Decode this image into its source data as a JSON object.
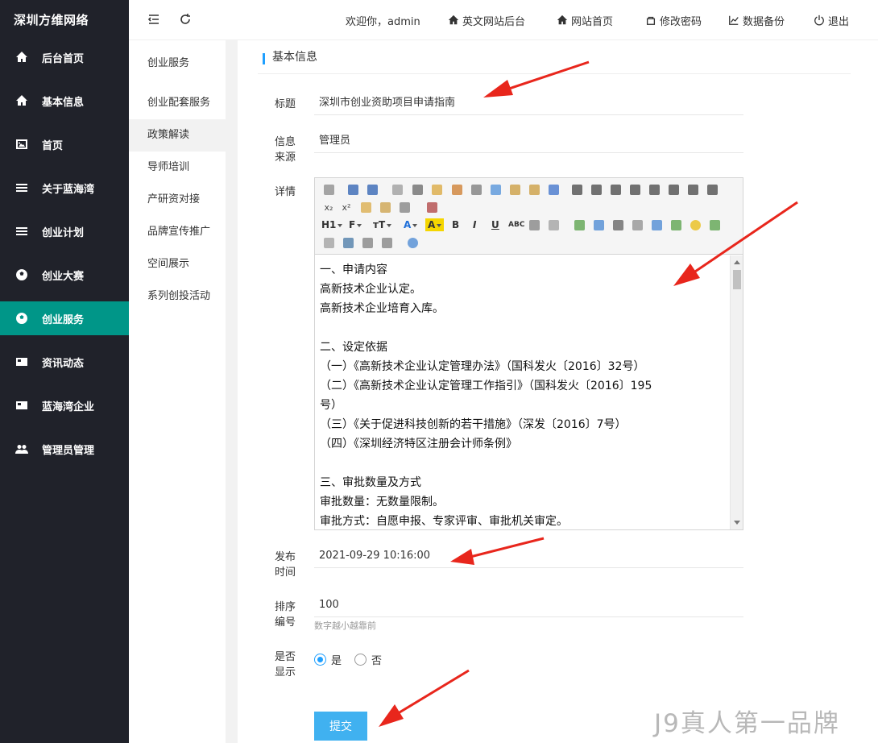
{
  "brand": "深圳方维网络",
  "sidebar": {
    "items": [
      {
        "label": "后台首页",
        "icon": "home-icon"
      },
      {
        "label": "基本信息",
        "icon": "home-icon"
      },
      {
        "label": "首页",
        "icon": "image-icon"
      },
      {
        "label": "关于蓝海湾",
        "icon": "menu-icon"
      },
      {
        "label": "创业计划",
        "icon": "menu-icon"
      },
      {
        "label": "创业大赛",
        "icon": "soccer-ball-icon"
      },
      {
        "label": "创业服务",
        "icon": "soccer-ball-icon",
        "active": true
      },
      {
        "label": "资讯动态",
        "icon": "newspaper-icon"
      },
      {
        "label": "蓝海湾企业",
        "icon": "newspaper-icon"
      },
      {
        "label": "管理员管理",
        "icon": "users-icon"
      }
    ]
  },
  "header": {
    "welcome": "欢迎你，admin",
    "links": {
      "en_admin": "英文网站后台",
      "site_home": "网站首页",
      "change_password": "修改密码",
      "backup": "数据备份",
      "logout": "退出"
    }
  },
  "submenu": {
    "items": [
      "创业服务",
      "创业配套服务",
      "政策解读",
      "导师培训",
      "产研资对接",
      "品牌宣传推广",
      "空间展示",
      "系列创投活动"
    ],
    "active_index": 2
  },
  "section_title": "基本信息",
  "form": {
    "title_label": "标题",
    "title_value": "深圳市创业资助项目申请指南",
    "source_label_1": "信息",
    "source_label_2": "来源",
    "source_value": "管理员",
    "detail_label": "详情",
    "publish_label_1": "发布",
    "publish_label_2": "时间",
    "publish_value": "2021-09-29 10:16:00",
    "sort_label_1": "排序",
    "sort_label_2": "编号",
    "sort_value": "100",
    "sort_hint": "数字越小越靠前",
    "show_label_1": "是否",
    "show_label_2": "显示",
    "show_yes": "是",
    "show_no": "否",
    "show_selected": "yes",
    "submit": "提交"
  },
  "editor": {
    "toolbar_text": {
      "heading": "H1",
      "font": "F",
      "size": "тT",
      "font_color": "A",
      "bg_color": "A",
      "bold": "B",
      "italic": "I",
      "underline": "U",
      "strike": "ABC",
      "sub": "x₂",
      "sup": "x²"
    },
    "content": [
      "一、申请内容",
      "高新技术企业认定。",
      "高新技术企业培育入库。",
      "",
      "二、设定依据",
      "（一）《高新技术企业认定管理办法》（国科发火〔2016〕32号）",
      "（二）《高新技术企业认定管理工作指引》（国科发火〔2016〕195",
      "号）",
      "（三）《关于促进科技创新的若干措施》（深发〔2016〕7号）",
      "（四）《深圳经济特区注册会计师条例》",
      "",
      "三、审批数量及方式",
      "审批数量：无数量限制。",
      "审批方式：自愿申报、专家评审、审批机关审定。"
    ]
  },
  "watermark": "J9真人第一品牌",
  "colors": {
    "sidebar_bg": "#20222a",
    "active_green": "#009688",
    "accent_blue": "#1e9fff",
    "submit_blue": "#40b1f0",
    "arrow_red": "#e8261c"
  }
}
